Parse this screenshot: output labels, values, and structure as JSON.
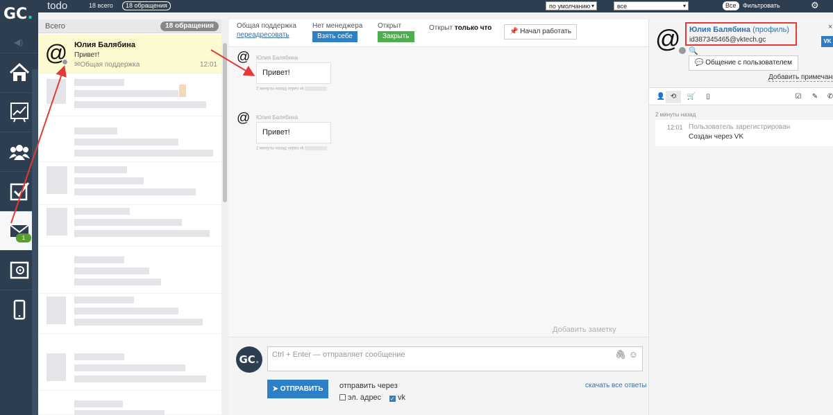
{
  "topbar": {
    "title": "todo",
    "total": "18 всего",
    "count_badge": "18 обращения",
    "sort_select": "по умолчанию",
    "filter_select": "все",
    "all_button": "Все",
    "filter_label": "Фильтровать"
  },
  "sidebar": {
    "logo": "GC",
    "logo_dot": ".",
    "nav_items": [
      "home-icon",
      "chart-icon",
      "users-icon",
      "tasks-icon",
      "mail-icon",
      "safe-icon",
      "phone-icon"
    ],
    "mail_badge": "1"
  },
  "list": {
    "header": "Всего",
    "badge": "18 обращения",
    "conversation": {
      "name": "Юлия Балябина",
      "text": "Привет!",
      "channel": "Общая поддержка",
      "time": "12:01"
    }
  },
  "chat": {
    "group_label": "Общая поддержка",
    "redirect_link": "переадресовать",
    "manager_label": "Нет менеджера",
    "take_button": "Взять себе",
    "status_label": "Открыт",
    "close_button": "Закрыть",
    "open_label": "Открыт",
    "open_value": "только что",
    "start_button": "Начал работать",
    "messages": [
      {
        "author": "Юлия Балябина",
        "text": "Привет!",
        "meta": "2 минуты назад через vk"
      },
      {
        "author": "Юлия Балябина",
        "text": "Привет!",
        "meta": "2 минуты назад через vk"
      }
    ],
    "add_note": "Добавить заметку",
    "compose": {
      "placeholder": "Ctrl + Enter — отправляет сообщение",
      "send_button": "ОТПРАВИТЬ",
      "send_via": "отправить через",
      "opt_email": "эл. адрес",
      "opt_vk": "vk",
      "show_all": "скачать все ответы"
    }
  },
  "user_panel": {
    "name": "Юлия Балябина",
    "profile_link": "(профиль)",
    "email": "id387345465@vktech.gc",
    "communication_button": "Общение с пользователем",
    "add_note": "Добавить примечание",
    "vk_badge": "VK",
    "close": "×",
    "activity_ago": "2 минуты назад",
    "event": {
      "time": "12:01",
      "line1": "Пользователь зарегистрирован",
      "line2": "Создан через VK"
    }
  },
  "colors": {
    "sidebar_bg": "#2d3e50",
    "accent_blue": "#2e80c6",
    "accent_green": "#4cae4c",
    "highlight_row": "#fdf9d0",
    "annotation_red": "#e53935"
  }
}
